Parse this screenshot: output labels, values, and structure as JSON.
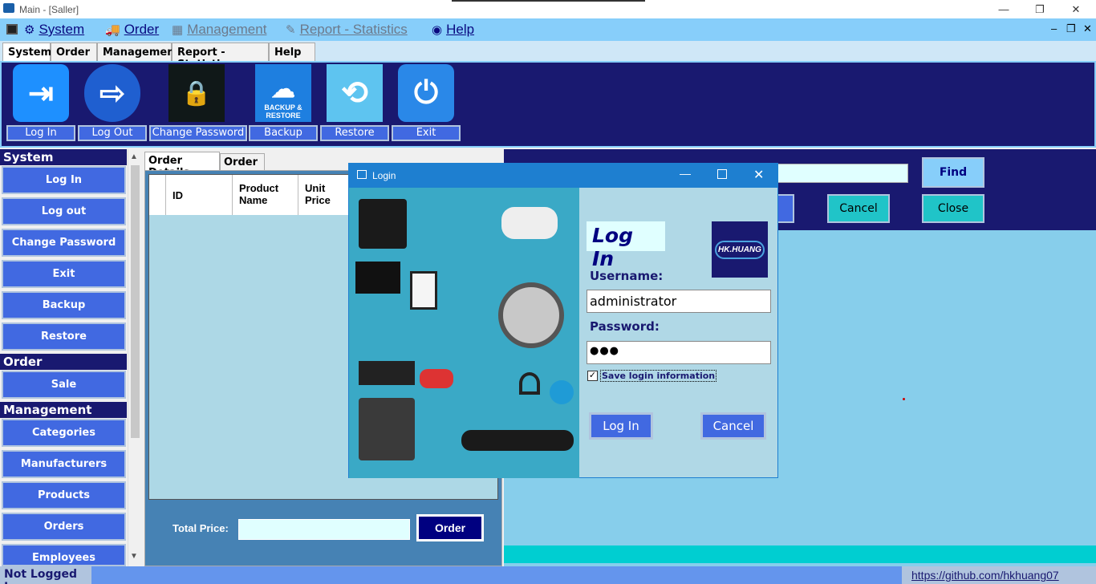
{
  "window": {
    "title": "Main - [Saller]",
    "controls": [
      "—",
      "❐",
      "✕"
    ]
  },
  "menu": [
    {
      "label": "System",
      "icon": "gears-icon",
      "disabled": false
    },
    {
      "label": "Order",
      "icon": "truck-icon",
      "disabled": false
    },
    {
      "label": "Management",
      "icon": "building-icon",
      "disabled": true
    },
    {
      "label": "Report - Statistics",
      "icon": "report-icon",
      "disabled": true
    },
    {
      "label": "Help",
      "icon": "help-icon",
      "disabled": false
    }
  ],
  "mdi_controls": [
    "‒",
    "❐",
    "✕"
  ],
  "tabs": [
    "System",
    "Order",
    "Management",
    "Report - Statistics",
    "Help"
  ],
  "ribbon": [
    {
      "label": "Log In",
      "icon": "login-icon"
    },
    {
      "label": "Log Out",
      "icon": "logout-icon"
    },
    {
      "label": "Change Password",
      "icon": "lock-icon"
    },
    {
      "label": "Backup",
      "icon": "backup-restore-icon",
      "icon_text": "BACKUP &",
      "icon_text2": "RESTORE"
    },
    {
      "label": "Restore",
      "icon": "restore-arrows-icon"
    },
    {
      "label": "Exit",
      "icon": "power-icon"
    }
  ],
  "sidebar": {
    "sections": [
      {
        "header": "System",
        "items": [
          "Log In",
          "Log out",
          "Change Password",
          "Exit",
          "Backup",
          "Restore"
        ]
      },
      {
        "header": "Order",
        "items": [
          "Sale"
        ]
      },
      {
        "header": "Management",
        "items": [
          "Categories",
          "Manufacturers",
          "Products",
          "Orders",
          "Employees"
        ]
      }
    ]
  },
  "order_panel": {
    "tabs": [
      "Order Details",
      "Order"
    ],
    "columns": [
      "ID",
      "Product Name",
      "Unit Price"
    ],
    "total_label": "Total Price:",
    "total_value": "",
    "order_button": "Order"
  },
  "right_panel": {
    "find": "Find",
    "cancel": "Cancel",
    "close": "Close",
    "search_value": ""
  },
  "login_dialog": {
    "title": "Login",
    "heading": "Log In",
    "logo_text": "HK.HUANG",
    "username_label": "Username:",
    "username_value": "administrator",
    "password_label": "Password:",
    "password_value": "●●●",
    "remember_label": "Save login information",
    "remember_checked": true,
    "login_button": "Log In",
    "cancel_button": "Cancel"
  },
  "status": {
    "text": "Not Logged In.",
    "link": "https://github.com/hkhuang07"
  },
  "colors": {
    "navy": "#191970",
    "royal": "#4169e1",
    "sky": "#87cefa",
    "cyan": "#20c4c8"
  }
}
